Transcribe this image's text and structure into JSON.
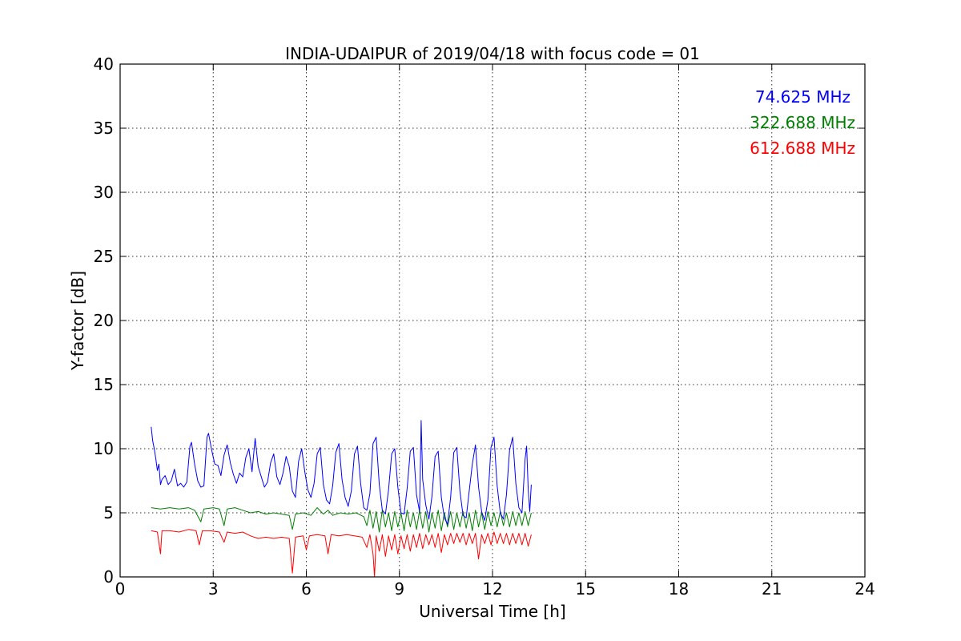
{
  "chart_data": {
    "type": "line",
    "title": "INDIA-UDAIPUR of 2019/04/18 with focus code = 01",
    "xlabel": "Universal Time [h]",
    "ylabel": "Y-factor [dB]",
    "xlim": [
      0,
      24
    ],
    "ylim": [
      0,
      40
    ],
    "xticks": [
      0,
      3,
      6,
      9,
      12,
      15,
      18,
      21,
      24
    ],
    "yticks": [
      0,
      5,
      10,
      15,
      20,
      25,
      30,
      35,
      40
    ],
    "grid": true,
    "legend_position": "top-right",
    "series": [
      {
        "name": "74.625 MHz",
        "color": "#0000ff",
        "points": [
          [
            1.0,
            11.7
          ],
          [
            1.05,
            10.6
          ],
          [
            1.1,
            10.0
          ],
          [
            1.15,
            9.2
          ],
          [
            1.2,
            8.3
          ],
          [
            1.25,
            8.8
          ],
          [
            1.3,
            7.2
          ],
          [
            1.35,
            7.6
          ],
          [
            1.45,
            7.9
          ],
          [
            1.55,
            7.2
          ],
          [
            1.65,
            7.5
          ],
          [
            1.75,
            8.4
          ],
          [
            1.85,
            7.1
          ],
          [
            1.95,
            7.3
          ],
          [
            2.05,
            7.0
          ],
          [
            2.15,
            7.4
          ],
          [
            2.25,
            10.2
          ],
          [
            2.3,
            10.5
          ],
          [
            2.4,
            8.8
          ],
          [
            2.5,
            7.5
          ],
          [
            2.6,
            7.0
          ],
          [
            2.7,
            7.1
          ],
          [
            2.8,
            10.9
          ],
          [
            2.85,
            11.2
          ],
          [
            2.95,
            9.9
          ],
          [
            3.05,
            8.8
          ],
          [
            3.15,
            8.7
          ],
          [
            3.25,
            7.9
          ],
          [
            3.35,
            9.5
          ],
          [
            3.45,
            10.3
          ],
          [
            3.55,
            8.9
          ],
          [
            3.65,
            8.0
          ],
          [
            3.75,
            7.3
          ],
          [
            3.85,
            8.1
          ],
          [
            3.95,
            7.8
          ],
          [
            4.05,
            9.3
          ],
          [
            4.15,
            10.0
          ],
          [
            4.25,
            8.2
          ],
          [
            4.35,
            10.8
          ],
          [
            4.45,
            8.6
          ],
          [
            4.55,
            7.8
          ],
          [
            4.65,
            7.0
          ],
          [
            4.75,
            7.4
          ],
          [
            4.85,
            8.9
          ],
          [
            4.95,
            9.6
          ],
          [
            5.05,
            7.8
          ],
          [
            5.15,
            7.2
          ],
          [
            5.25,
            8.1
          ],
          [
            5.35,
            9.4
          ],
          [
            5.45,
            8.6
          ],
          [
            5.55,
            6.7
          ],
          [
            5.65,
            6.2
          ],
          [
            5.75,
            9.0
          ],
          [
            5.85,
            10.0
          ],
          [
            5.95,
            8.2
          ],
          [
            6.05,
            6.8
          ],
          [
            6.15,
            6.2
          ],
          [
            6.25,
            7.3
          ],
          [
            6.35,
            9.6
          ],
          [
            6.45,
            10.1
          ],
          [
            6.55,
            7.2
          ],
          [
            6.65,
            6.0
          ],
          [
            6.75,
            5.7
          ],
          [
            6.85,
            7.1
          ],
          [
            6.95,
            9.7
          ],
          [
            7.05,
            10.4
          ],
          [
            7.15,
            7.6
          ],
          [
            7.25,
            6.2
          ],
          [
            7.35,
            5.5
          ],
          [
            7.45,
            6.7
          ],
          [
            7.55,
            9.6
          ],
          [
            7.65,
            10.2
          ],
          [
            7.75,
            7.3
          ],
          [
            7.85,
            5.4
          ],
          [
            7.95,
            5.2
          ],
          [
            8.05,
            6.5
          ],
          [
            8.15,
            10.4
          ],
          [
            8.25,
            10.9
          ],
          [
            8.35,
            7.2
          ],
          [
            8.45,
            5.2
          ],
          [
            8.55,
            4.9
          ],
          [
            8.65,
            6.8
          ],
          [
            8.75,
            9.6
          ],
          [
            8.85,
            10.0
          ],
          [
            8.95,
            7.0
          ],
          [
            9.05,
            5.0
          ],
          [
            9.15,
            4.9
          ],
          [
            9.25,
            6.9
          ],
          [
            9.35,
            9.8
          ],
          [
            9.45,
            10.1
          ],
          [
            9.55,
            6.4
          ],
          [
            9.65,
            5.1
          ],
          [
            9.7,
            12.2
          ],
          [
            9.75,
            7.6
          ],
          [
            9.85,
            5.6
          ],
          [
            9.95,
            4.5
          ],
          [
            10.05,
            6.3
          ],
          [
            10.15,
            9.4
          ],
          [
            10.25,
            9.8
          ],
          [
            10.35,
            6.2
          ],
          [
            10.45,
            4.6
          ],
          [
            10.55,
            4.1
          ],
          [
            10.65,
            6.2
          ],
          [
            10.75,
            9.7
          ],
          [
            10.85,
            10.1
          ],
          [
            10.95,
            6.7
          ],
          [
            11.05,
            4.8
          ],
          [
            11.15,
            4.6
          ],
          [
            11.25,
            6.7
          ],
          [
            11.35,
            8.8
          ],
          [
            11.45,
            10.3
          ],
          [
            11.55,
            7.0
          ],
          [
            11.65,
            5.1
          ],
          [
            11.75,
            4.4
          ],
          [
            11.85,
            6.0
          ],
          [
            11.95,
            10.1
          ],
          [
            12.05,
            10.9
          ],
          [
            12.15,
            7.1
          ],
          [
            12.25,
            5.0
          ],
          [
            12.35,
            4.5
          ],
          [
            12.45,
            6.4
          ],
          [
            12.55,
            9.9
          ],
          [
            12.65,
            10.9
          ],
          [
            12.75,
            7.3
          ],
          [
            12.85,
            5.4
          ],
          [
            12.95,
            5.0
          ],
          [
            13.05,
            9.2
          ],
          [
            13.1,
            10.2
          ],
          [
            13.15,
            6.8
          ],
          [
            13.2,
            5.1
          ],
          [
            13.25,
            7.2
          ]
        ]
      },
      {
        "name": "322.688 MHz",
        "color": "#008000",
        "points": [
          [
            1.0,
            5.4
          ],
          [
            1.3,
            5.3
          ],
          [
            1.6,
            5.4
          ],
          [
            1.9,
            5.3
          ],
          [
            2.2,
            5.4
          ],
          [
            2.4,
            5.2
          ],
          [
            2.6,
            4.3
          ],
          [
            2.7,
            5.3
          ],
          [
            3.0,
            5.4
          ],
          [
            3.2,
            5.3
          ],
          [
            3.35,
            4.0
          ],
          [
            3.45,
            5.3
          ],
          [
            3.7,
            5.4
          ],
          [
            3.95,
            5.2
          ],
          [
            4.2,
            5.0
          ],
          [
            4.45,
            5.1
          ],
          [
            4.7,
            4.9
          ],
          [
            4.95,
            5.0
          ],
          [
            5.2,
            4.9
          ],
          [
            5.45,
            4.8
          ],
          [
            5.55,
            3.7
          ],
          [
            5.65,
            4.9
          ],
          [
            5.9,
            5.0
          ],
          [
            6.15,
            4.8
          ],
          [
            6.35,
            5.4
          ],
          [
            6.55,
            4.9
          ],
          [
            6.7,
            5.2
          ],
          [
            6.85,
            4.8
          ],
          [
            7.1,
            5.0
          ],
          [
            7.35,
            4.9
          ],
          [
            7.6,
            5.0
          ],
          [
            7.85,
            4.7
          ],
          [
            7.95,
            4.0
          ],
          [
            8.05,
            5.2
          ],
          [
            8.15,
            3.8
          ],
          [
            8.25,
            5.1
          ],
          [
            8.35,
            3.5
          ],
          [
            8.45,
            5.2
          ],
          [
            8.55,
            3.9
          ],
          [
            8.65,
            5.0
          ],
          [
            8.75,
            3.6
          ],
          [
            8.85,
            5.1
          ],
          [
            8.95,
            3.9
          ],
          [
            9.05,
            5.0
          ],
          [
            9.15,
            3.6
          ],
          [
            9.25,
            5.2
          ],
          [
            9.35,
            3.9
          ],
          [
            9.45,
            5.0
          ],
          [
            9.55,
            3.7
          ],
          [
            9.65,
            5.2
          ],
          [
            9.75,
            3.8
          ],
          [
            9.85,
            5.1
          ],
          [
            9.95,
            3.5
          ],
          [
            10.05,
            5.0
          ],
          [
            10.15,
            3.8
          ],
          [
            10.25,
            5.2
          ],
          [
            10.35,
            3.6
          ],
          [
            10.45,
            5.0
          ],
          [
            10.55,
            3.9
          ],
          [
            10.65,
            5.1
          ],
          [
            10.75,
            3.7
          ],
          [
            10.85,
            5.0
          ],
          [
            10.95,
            3.9
          ],
          [
            11.05,
            5.1
          ],
          [
            11.15,
            3.8
          ],
          [
            11.25,
            5.0
          ],
          [
            11.35,
            3.6
          ],
          [
            11.45,
            5.2
          ],
          [
            11.55,
            3.9
          ],
          [
            11.65,
            5.0
          ],
          [
            11.75,
            3.7
          ],
          [
            11.85,
            5.1
          ],
          [
            11.95,
            4.0
          ],
          [
            12.05,
            5.0
          ],
          [
            12.15,
            3.9
          ],
          [
            12.25,
            5.1
          ],
          [
            12.35,
            4.0
          ],
          [
            12.45,
            5.0
          ],
          [
            12.55,
            3.9
          ],
          [
            12.65,
            5.1
          ],
          [
            12.75,
            4.0
          ],
          [
            12.85,
            5.0
          ],
          [
            12.95,
            4.0
          ],
          [
            13.05,
            5.1
          ],
          [
            13.15,
            4.0
          ],
          [
            13.25,
            5.0
          ]
        ]
      },
      {
        "name": "612.688 MHz",
        "color": "#ff0000",
        "points": [
          [
            1.0,
            3.6
          ],
          [
            1.2,
            3.5
          ],
          [
            1.3,
            1.8
          ],
          [
            1.35,
            3.6
          ],
          [
            1.6,
            3.6
          ],
          [
            1.9,
            3.5
          ],
          [
            2.2,
            3.7
          ],
          [
            2.45,
            3.6
          ],
          [
            2.55,
            2.5
          ],
          [
            2.65,
            3.6
          ],
          [
            2.9,
            3.6
          ],
          [
            3.2,
            3.5
          ],
          [
            3.35,
            2.7
          ],
          [
            3.45,
            3.5
          ],
          [
            3.7,
            3.4
          ],
          [
            3.95,
            3.5
          ],
          [
            4.2,
            3.2
          ],
          [
            4.45,
            3.0
          ],
          [
            4.7,
            3.1
          ],
          [
            4.95,
            3.0
          ],
          [
            5.2,
            3.1
          ],
          [
            5.45,
            3.0
          ],
          [
            5.55,
            0.3
          ],
          [
            5.65,
            3.1
          ],
          [
            5.9,
            3.2
          ],
          [
            6.0,
            2.1
          ],
          [
            6.1,
            3.2
          ],
          [
            6.35,
            3.3
          ],
          [
            6.6,
            3.2
          ],
          [
            6.7,
            1.8
          ],
          [
            6.8,
            3.3
          ],
          [
            7.05,
            3.2
          ],
          [
            7.3,
            3.3
          ],
          [
            7.55,
            3.2
          ],
          [
            7.8,
            3.1
          ],
          [
            7.95,
            2.3
          ],
          [
            8.05,
            3.3
          ],
          [
            8.15,
            1.8
          ],
          [
            8.2,
            0.0
          ],
          [
            8.25,
            3.2
          ],
          [
            8.35,
            2.0
          ],
          [
            8.45,
            3.3
          ],
          [
            8.55,
            1.6
          ],
          [
            8.65,
            3.2
          ],
          [
            8.75,
            2.1
          ],
          [
            8.85,
            3.3
          ],
          [
            8.95,
            1.8
          ],
          [
            9.05,
            3.2
          ],
          [
            9.15,
            2.2
          ],
          [
            9.25,
            3.3
          ],
          [
            9.35,
            2.0
          ],
          [
            9.45,
            3.3
          ],
          [
            9.55,
            2.3
          ],
          [
            9.65,
            3.4
          ],
          [
            9.75,
            2.2
          ],
          [
            9.85,
            3.3
          ],
          [
            9.95,
            2.5
          ],
          [
            10.05,
            3.3
          ],
          [
            10.15,
            2.3
          ],
          [
            10.25,
            3.4
          ],
          [
            10.35,
            1.9
          ],
          [
            10.45,
            3.3
          ],
          [
            10.55,
            2.5
          ],
          [
            10.65,
            3.4
          ],
          [
            10.75,
            2.6
          ],
          [
            10.85,
            3.4
          ],
          [
            10.95,
            2.7
          ],
          [
            11.05,
            3.4
          ],
          [
            11.15,
            2.5
          ],
          [
            11.25,
            3.4
          ],
          [
            11.35,
            2.6
          ],
          [
            11.45,
            3.4
          ],
          [
            11.55,
            1.4
          ],
          [
            11.65,
            3.3
          ],
          [
            11.75,
            2.6
          ],
          [
            11.85,
            3.4
          ],
          [
            11.95,
            2.5
          ],
          [
            12.05,
            3.5
          ],
          [
            12.15,
            2.6
          ],
          [
            12.25,
            3.4
          ],
          [
            12.35,
            2.6
          ],
          [
            12.45,
            3.4
          ],
          [
            12.55,
            2.5
          ],
          [
            12.65,
            3.4
          ],
          [
            12.75,
            2.6
          ],
          [
            12.85,
            3.4
          ],
          [
            12.95,
            2.5
          ],
          [
            13.05,
            3.4
          ],
          [
            13.15,
            2.4
          ],
          [
            13.25,
            3.3
          ]
        ]
      }
    ]
  }
}
